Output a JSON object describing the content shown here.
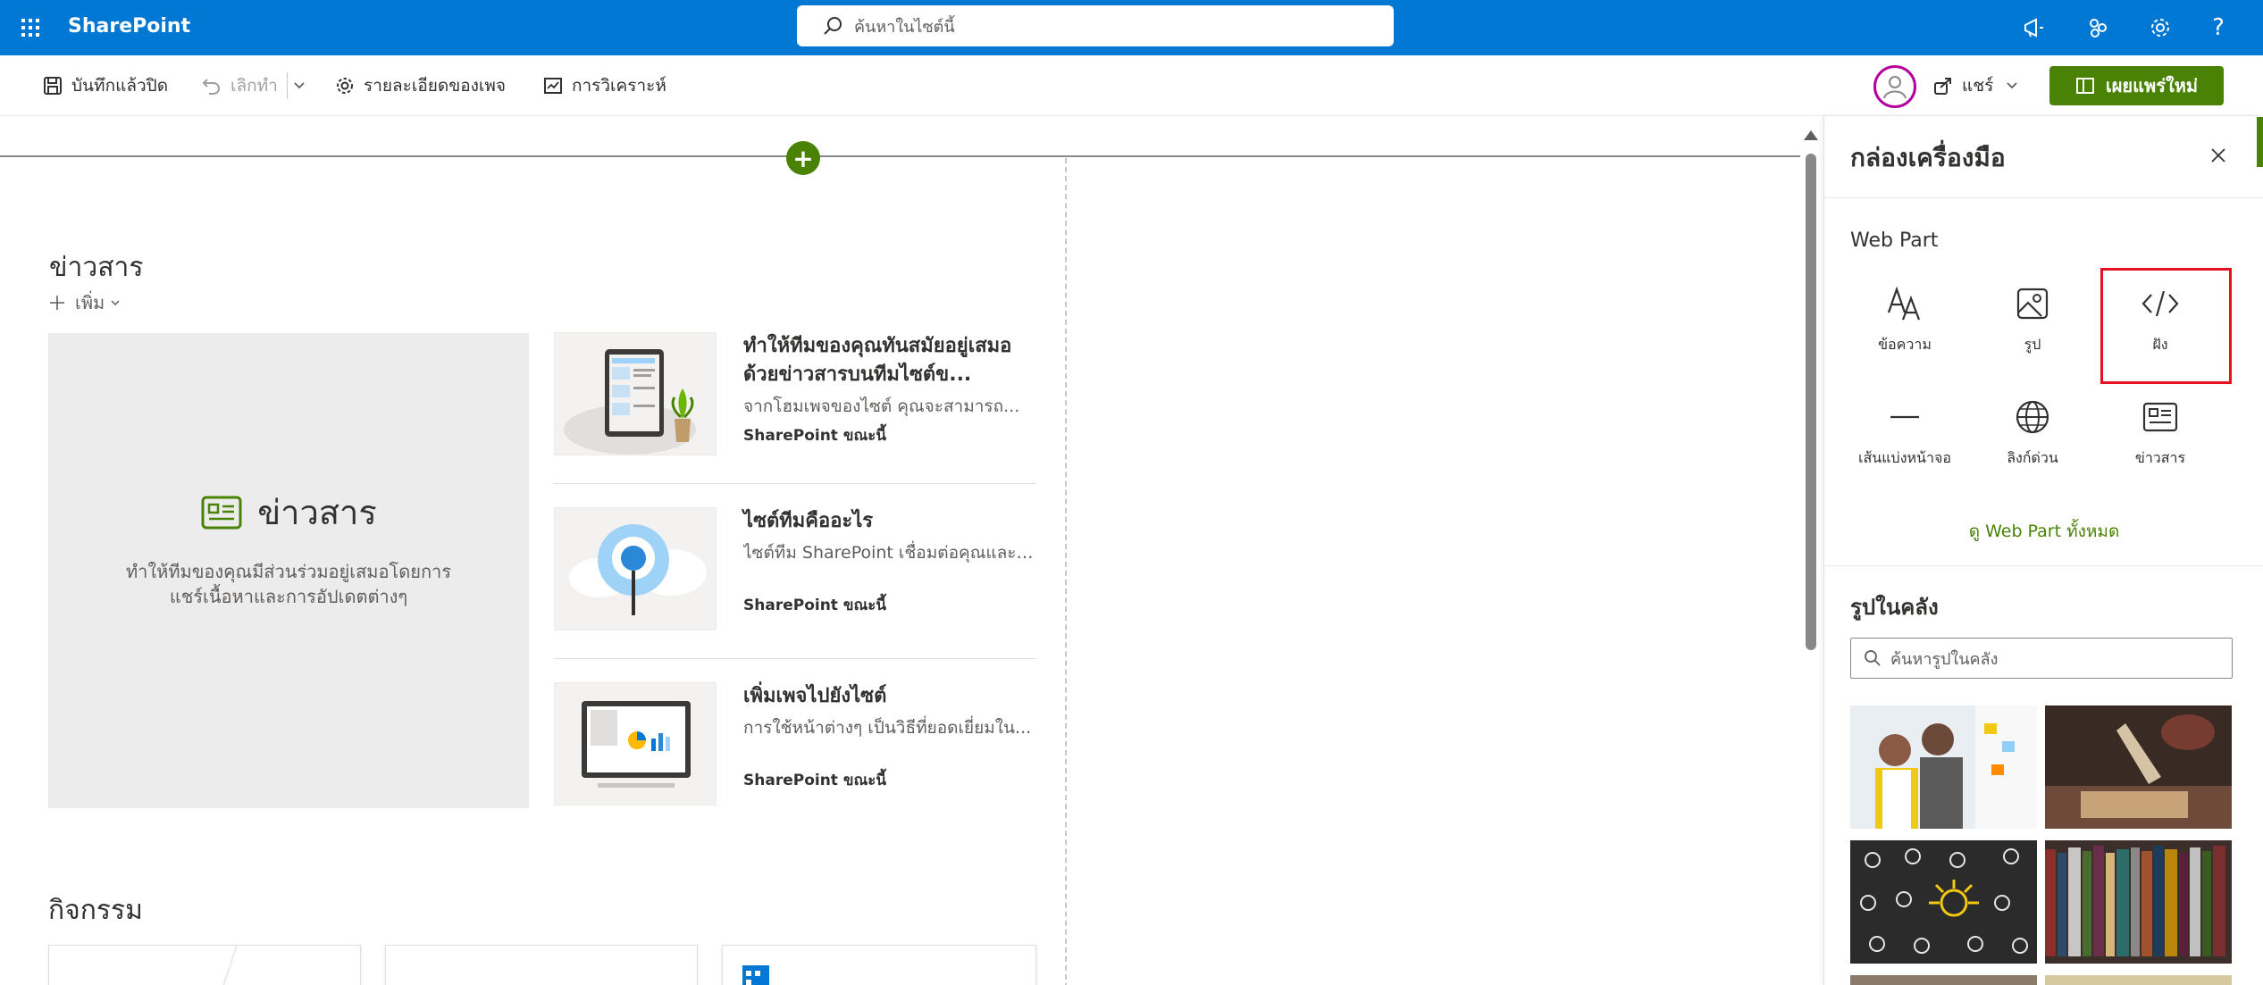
{
  "suite": {
    "brand": "SharePoint",
    "search_placeholder": "ค้นหาในไซต์นี้"
  },
  "commands": {
    "save_close": "บันทึกแล้วปิด",
    "discard": "เลิกทำ",
    "page_details": "รายละเอียดของเพจ",
    "analytics": "การวิเคราะห์",
    "share": "แชร์",
    "publish": "เผยแพร่ใหม่"
  },
  "news": {
    "section_title": "ข่าวสาร",
    "add_label": "เพิ่ม",
    "hero_title": "ข่าวสาร",
    "hero_desc": "ทำให้ทีมของคุณมีส่วนร่วมอยู่เสมอโดยการแชร์เนื้อหาและการอัปเดตต่างๆ",
    "items": [
      {
        "headline": "ทำให้ทีมของคุณทันสมัยอยู่เสมอด้วยข่าวสารบนทีมไซต์ข...",
        "desc": "จากโฮมเพจของไซต์ คุณจะสามารถ...",
        "meta": "SharePoint ขณะนี้"
      },
      {
        "headline": "ไซต์ทีมคืออะไร",
        "desc": "ไซต์ทีม SharePoint เชื่อมต่อคุณและที...",
        "meta": "SharePoint ขณะนี้"
      },
      {
        "headline": "เพิ่มเพจไปยังไซต์",
        "desc": "การใช้หน้าต่างๆ เป็นวิธีที่ยอดเยี่ยมใน...",
        "meta": "SharePoint ขณะนี้"
      }
    ]
  },
  "events": {
    "section_title": "กิจกรรม"
  },
  "toolbox": {
    "title": "กล่องเครื่องมือ",
    "webpart_label": "Web Part",
    "tiles": [
      {
        "label": "ข้อความ",
        "icon": "text-icon"
      },
      {
        "label": "รูป",
        "icon": "image-icon"
      },
      {
        "label": "ฝัง",
        "icon": "embed-code-icon"
      },
      {
        "label": "เส้นแบ่งหน้าจอ",
        "icon": "divider-icon"
      },
      {
        "label": "ลิงก์ด่วน",
        "icon": "globe-icon"
      },
      {
        "label": "ข่าวสาร",
        "icon": "news-icon"
      }
    ],
    "see_all": "ดู Web Part ทั้งหมด",
    "stock_label": "รูปในคลัง",
    "stock_search_placeholder": "ค้นหารูปในคลัง"
  },
  "colors": {
    "suite_bar": "#0078d4",
    "publish_green": "#498205",
    "highlight_red": "#e81123"
  }
}
